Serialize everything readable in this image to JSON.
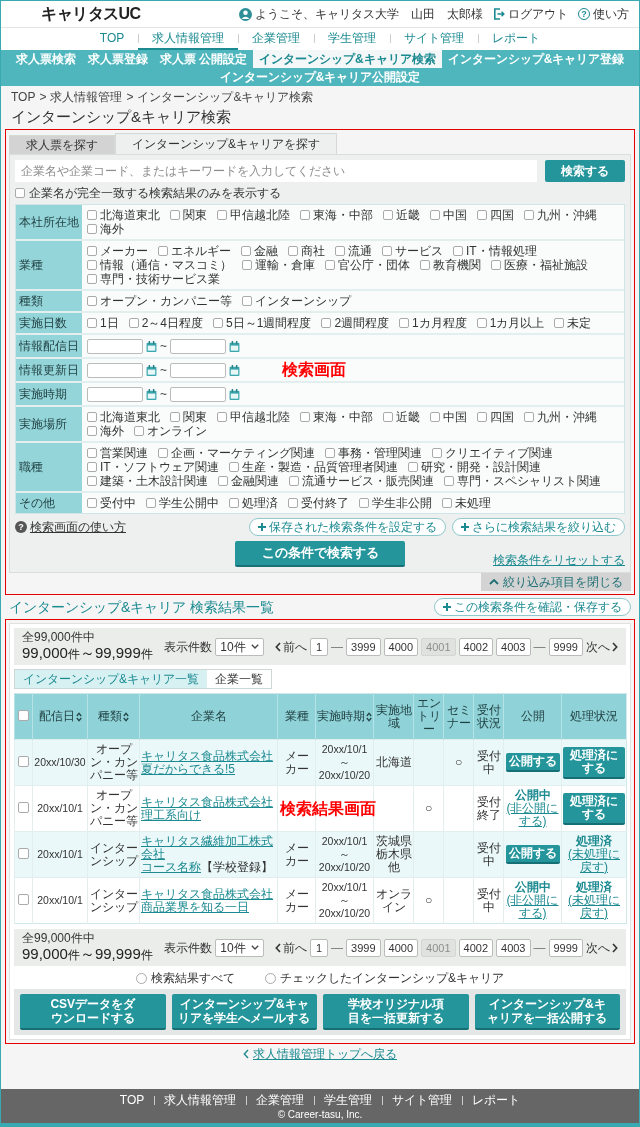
{
  "header": {
    "logo": "キャリタスUC",
    "welcome": "ようこそ、キャリタス大学　山田　太郎様",
    "logout": "ログアウト",
    "help": {
      "icon": "?",
      "label": "使い方"
    }
  },
  "nav": [
    {
      "label": "TOP",
      "selected": false
    },
    {
      "label": "求人情報管理",
      "selected": true
    },
    {
      "label": "企業管理",
      "selected": false
    },
    {
      "label": "学生管理",
      "selected": false
    },
    {
      "label": "サイト管理",
      "selected": false
    },
    {
      "label": "レポート",
      "selected": false
    }
  ],
  "subnav": [
    {
      "label": "求人票検索",
      "selected": false
    },
    {
      "label": "求人票登録",
      "selected": false
    },
    {
      "label": "求人票 公開設定",
      "selected": false
    },
    {
      "label": "インターンシップ&キャリア検索",
      "selected": true
    },
    {
      "label": "インターンシップ&キャリア登録",
      "selected": false
    },
    {
      "label": "インターンシップ&キャリア公開設定",
      "selected": false
    }
  ],
  "breadcrumb": {
    "items": [
      "TOP",
      "求人情報管理",
      "インターンシップ&キャリア検索"
    ],
    "separators": [
      ">",
      ">"
    ]
  },
  "page_title": "インターンシップ&キャリア検索",
  "annotations": [
    {
      "label": "検索画面"
    },
    {
      "label": "検索結果画面"
    }
  ],
  "search": {
    "tabs": [
      {
        "label": "求人票を探す",
        "selected": false
      },
      {
        "label": "インターンシップ&キャリアを探す",
        "selected": true
      }
    ],
    "keyword": {
      "placeholder": "企業名や企業コード、またはキーワードを入力してください"
    },
    "search_button": "検索する",
    "exact_match": {
      "label": "企業名が完全一致する検索結果のみを表示する",
      "checked": false
    },
    "criteria": [
      {
        "label": "本社所在地",
        "kind": "checks",
        "options": [
          {
            "label": "北海道東北",
            "checked": false
          },
          {
            "label": "関東",
            "checked": false
          },
          {
            "label": "甲信越北陸",
            "checked": false
          },
          {
            "label": "東海・中部",
            "checked": false
          },
          {
            "label": "近畿",
            "checked": false
          },
          {
            "label": "中国",
            "checked": false
          },
          {
            "label": "四国",
            "checked": false
          },
          {
            "label": "九州・沖縄",
            "checked": false
          },
          {
            "label": "海外",
            "checked": false
          }
        ]
      },
      {
        "label": "業種",
        "kind": "checks",
        "options": [
          {
            "label": "メーカー",
            "checked": false
          },
          {
            "label": "エネルギー",
            "checked": false
          },
          {
            "label": "金融",
            "checked": false
          },
          {
            "label": "商社",
            "checked": false
          },
          {
            "label": "流通",
            "checked": false
          },
          {
            "label": "サービス",
            "checked": false
          },
          {
            "label": "IT・情報処理",
            "checked": false
          },
          {
            "label": "情報（通信・マスコミ）",
            "checked": false
          },
          {
            "label": "運輸・倉庫",
            "checked": false
          },
          {
            "label": "官公庁・団体",
            "checked": false
          },
          {
            "label": "教育機関",
            "checked": false
          },
          {
            "label": "医療・福祉施設",
            "checked": false
          },
          {
            "label": "専門・技術サービス業",
            "checked": false
          }
        ]
      },
      {
        "label": "種類",
        "kind": "checks",
        "options": [
          {
            "label": "オープン・カンパニー等",
            "checked": false
          },
          {
            "label": "インターンシップ",
            "checked": false
          }
        ]
      },
      {
        "label": "実施日数",
        "kind": "checks",
        "options": [
          {
            "label": "1日",
            "checked": false
          },
          {
            "label": "2～4日程度",
            "checked": false
          },
          {
            "label": "5日～1週間程度",
            "checked": false
          },
          {
            "label": "2週間程度",
            "checked": false
          },
          {
            "label": "1カ月程度",
            "checked": false
          },
          {
            "label": "1カ月以上",
            "checked": false
          },
          {
            "label": "未定",
            "checked": false
          }
        ]
      },
      {
        "label": "情報配信日",
        "kind": "dates",
        "separator": "~"
      },
      {
        "label": "情報更新日",
        "kind": "dates",
        "separator": "~"
      },
      {
        "label": "実施時期",
        "kind": "dates",
        "separator": "~"
      },
      {
        "label": "実施場所",
        "kind": "checks",
        "options": [
          {
            "label": "北海道東北",
            "checked": false
          },
          {
            "label": "関東",
            "checked": false
          },
          {
            "label": "甲信越北陸",
            "checked": false
          },
          {
            "label": "東海・中部",
            "checked": false
          },
          {
            "label": "近畿",
            "checked": false
          },
          {
            "label": "中国",
            "checked": false
          },
          {
            "label": "四国",
            "checked": false
          },
          {
            "label": "九州・沖縄",
            "checked": false
          },
          {
            "label": "海外",
            "checked": false
          },
          {
            "label": "オンライン",
            "checked": false
          }
        ]
      },
      {
        "label": "職種",
        "kind": "checks",
        "options": [
          {
            "label": "営業関連",
            "checked": false
          },
          {
            "label": "企画・マーケティング関連",
            "checked": false
          },
          {
            "label": "事務・管理関連",
            "checked": false
          },
          {
            "label": "クリエイティブ関連",
            "checked": false
          },
          {
            "label": "IT・ソフトウェア関連",
            "checked": false
          },
          {
            "label": "生産・製造・品質管理者関連",
            "checked": false
          },
          {
            "label": "研究・開発・設計関連",
            "checked": false
          },
          {
            "label": "建築・土木設計関連",
            "checked": false
          },
          {
            "label": "金融関連",
            "checked": false
          },
          {
            "label": "流通サービス・販売関連",
            "checked": false
          },
          {
            "label": "専門・スペシャリスト関連",
            "checked": false
          }
        ]
      },
      {
        "label": "その他",
        "kind": "checks",
        "options": [
          {
            "label": "受付中",
            "checked": false
          },
          {
            "label": "学生公開中",
            "checked": false
          },
          {
            "label": "処理済",
            "checked": false
          },
          {
            "label": "受付終了",
            "checked": false
          },
          {
            "label": "学生非公開",
            "checked": false
          },
          {
            "label": "未処理",
            "checked": false
          }
        ]
      }
    ],
    "help": {
      "icon": "?",
      "label": "検索画面の使い方"
    },
    "saved_button": "保存された検索条件を設定する",
    "refine_button": "さらに検索結果を絞り込む",
    "submit": "この条件で検索する",
    "reset": "検索条件をリセットする",
    "close": "絞り込み項目を閉じる"
  },
  "results": {
    "title": "インターンシップ&キャリア 検索結果一覧",
    "save_button": "この検索条件を確認・保存する",
    "pager_top": {
      "total": "全99,000件中",
      "from": {
        "number": "99,000",
        "unit": "件"
      },
      "range_separator": "～",
      "to": {
        "number": "99,999",
        "unit": "件"
      },
      "per_page_label": "表示件数",
      "per_page": "10件",
      "prev": "前へ",
      "next": "次へ",
      "pages": [
        {
          "label": "1",
          "kind": "page",
          "selected": false
        },
        {
          "label": "—",
          "kind": "gap"
        },
        {
          "label": "3999",
          "kind": "page",
          "selected": false
        },
        {
          "label": "4000",
          "kind": "page",
          "selected": false
        },
        {
          "label": "4001",
          "kind": "page",
          "selected": true
        },
        {
          "label": "4002",
          "kind": "page",
          "selected": false
        },
        {
          "label": "4003",
          "kind": "page",
          "selected": false
        },
        {
          "label": "—",
          "kind": "gap"
        },
        {
          "label": "9999",
          "kind": "page",
          "selected": false
        }
      ]
    },
    "views": [
      {
        "label": "インターンシップ&キャリア一覧",
        "selected": true
      },
      {
        "label": "企業一覧",
        "selected": false
      }
    ],
    "table": {
      "select_all": {
        "checked": false
      },
      "columns": [
        {
          "label": "配信日",
          "sortable": true
        },
        {
          "label": "種類",
          "sortable": true
        },
        {
          "label": "企業名",
          "sortable": false
        },
        {
          "label": "業種",
          "sortable": false
        },
        {
          "label": "実施時期",
          "sortable": true
        },
        {
          "label": "実施地域",
          "sortable": false
        },
        {
          "label": "エントリー",
          "sortable": false
        },
        {
          "label": "セミナー",
          "sortable": false
        },
        {
          "label": "受付状況",
          "sortable": false
        },
        {
          "label": "公開",
          "sortable": false
        },
        {
          "label": "処理状況",
          "sortable": false
        }
      ],
      "rows": [
        {
          "checked": false,
          "date": "20xx/10/30",
          "type": "オープン・カンパニー等",
          "company": "キャリタス食品株式会社",
          "course": "夏だからできる!5",
          "industry": "メーカー",
          "period": {
            "from": "20xx/10/1",
            "separator": "～",
            "to": "20xx/10/20"
          },
          "region": "北海道",
          "seminar": "○",
          "reception": "受付中",
          "publish": {
            "kind": "button",
            "label": "公開する"
          },
          "processing": {
            "kind": "button",
            "label": "処理済にする"
          }
        },
        {
          "checked": false,
          "date": "20xx/10/1",
          "type": "オープン・カンパニー等",
          "company": "キャリタス食品株式会社",
          "course": "理工系向け",
          "entry": "○",
          "reception": "受付終了",
          "publish": {
            "kind": "status",
            "label": "公開中",
            "link": "(非公開にする)"
          },
          "processing": {
            "kind": "button",
            "label": "処理済にする"
          }
        },
        {
          "checked": false,
          "date": "20xx/10/1",
          "type": "インターンシップ",
          "company": "キャリタス繊維加工株式会社",
          "course": "コース名称",
          "note": "【学校登録】",
          "industry": "メーカー",
          "period": {
            "from": "20xx/10/1",
            "separator": "～",
            "to": "20xx/10/20"
          },
          "region": "茨城県栃木県他",
          "reception": "受付中",
          "publish": {
            "kind": "button",
            "label": "公開する"
          },
          "processing": {
            "kind": "status",
            "label": "処理済",
            "link": "(未処理に戻す)"
          }
        },
        {
          "checked": false,
          "date": "20xx/10/1",
          "type": "インターンシップ",
          "company": "キャリタス食品株式会社",
          "course": "商品業界を知る一日",
          "industry": "メーカー",
          "period": {
            "from": "20xx/10/1",
            "separator": "～",
            "to": "20xx/10/20"
          },
          "region": "オンライン",
          "entry": "○",
          "reception": "受付中",
          "publish": {
            "kind": "status",
            "label": "公開中",
            "link": "(非公開にする)"
          },
          "processing": {
            "kind": "status",
            "label": "処理済",
            "link": "(未処理に戻す)"
          }
        }
      ]
    },
    "pager_bottom": {
      "total": "全99,000件中",
      "from": {
        "number": "99,000",
        "unit": "件"
      },
      "range_separator": "～",
      "to": {
        "number": "99,999",
        "unit": "件"
      },
      "per_page_label": "表示件数",
      "per_page": "10件",
      "prev": "前へ",
      "next": "次へ",
      "pages": [
        {
          "label": "1",
          "kind": "page",
          "selected": false
        },
        {
          "label": "—",
          "kind": "gap"
        },
        {
          "label": "3999",
          "kind": "page",
          "selected": false
        },
        {
          "label": "4000",
          "kind": "page",
          "selected": false
        },
        {
          "label": "4001",
          "kind": "page",
          "selected": true
        },
        {
          "label": "4002",
          "kind": "page",
          "selected": false
        },
        {
          "label": "4003",
          "kind": "page",
          "selected": false
        },
        {
          "label": "—",
          "kind": "gap"
        },
        {
          "label": "9999",
          "kind": "page",
          "selected": false
        }
      ]
    },
    "targets": [
      {
        "label": "検索結果すべて",
        "selected": false
      },
      {
        "label": "チェックしたインターンシップ&キャリア",
        "selected": false
      }
    ],
    "actions": [
      "CSVデータをダウンロードする",
      "インターンシップ&キャリアを学生へメールする",
      "学校オリジナル項目を一括更新する",
      "インターンシップ&キャリアを一括公開する"
    ]
  },
  "back_link": "求人情報管理トップへ戻る",
  "footer": {
    "links": [
      "TOP",
      "求人情報管理",
      "企業管理",
      "学生管理",
      "サイト管理",
      "レポート"
    ],
    "copyright": "© Career-tasu, Inc."
  }
}
